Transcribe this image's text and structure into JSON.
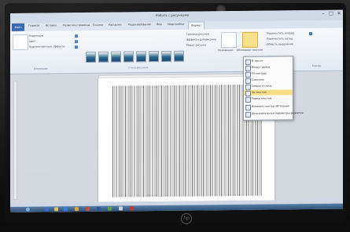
{
  "image": {
    "subject": "photo-of-laptop-screen",
    "screen": {
      "window_title": "Работа с рисунками",
      "tabs": [
        "Файл",
        "Главная",
        "Вставка",
        "Разметка страницы",
        "Ссылки",
        "Рассылки",
        "Рецензирование",
        "Вид",
        "Надстройки",
        "Формат"
      ],
      "active_tab": "Формат",
      "ribbon": {
        "left_items": [
          "Коррекция",
          "Цвет",
          "Художественные эффекты"
        ],
        "picture_styles_label": "Стили рисунков",
        "right_items": [
          "Граница рисунка",
          "Эффекты для рисунка",
          "Макет рисунка"
        ],
        "arrange_items": [
          "Переместить вперед",
          "Переместить назад",
          "Область выделения"
        ],
        "position_label": "Положение",
        "wrap_label": "Обтекание текстом",
        "group_label_adjust": "Изменение",
        "group_label_size": "Размер"
      },
      "wrap_menu": {
        "items": [
          "В тексте",
          "Вокруг рамки",
          "По контуру",
          "Сквозное",
          "Сверху и снизу",
          "За текстом",
          "Перед текстом",
          "Изменить контур обтекания",
          "Дополнительные параметры разметки"
        ],
        "highlighted": "За текстом"
      },
      "colors": {
        "ribbon": "#e6ecf4",
        "file_tab": "#2a5fa8",
        "highlight": "#f7df8a",
        "taskbar": "#2f5178"
      }
    },
    "brand": "hp"
  }
}
